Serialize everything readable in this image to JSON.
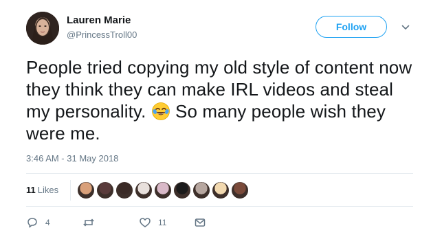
{
  "author": {
    "display_name": "Lauren Marie",
    "handle": "@PrincessTroll00"
  },
  "follow_button": {
    "label": "Follow"
  },
  "tweet": {
    "text_before_emoji": "People tried copying my old style of content now they think they can make IRL videos and steal my personality. ",
    "emoji": "face-with-tears-of-joy",
    "text_after_emoji": " So many people wish they were me.",
    "timestamp": "3:46 AM - 31 May 2018"
  },
  "stats": {
    "likes_count": "11",
    "likes_label": "Likes",
    "liker_avatar_colors": [
      "#d9a07a",
      "#5a3b3b",
      "#3a2a26",
      "#e8e0dc",
      "#d9b9c8",
      "#1b1b1b",
      "#b7a7a0",
      "#f2d9b0",
      "#7a4a3a"
    ]
  },
  "actions": {
    "reply_count": "4",
    "retweet_count": "",
    "like_count": "11"
  },
  "colors": {
    "accent": "#1da1f2",
    "secondary_text": "#657786",
    "divider": "#e6ecf0"
  }
}
